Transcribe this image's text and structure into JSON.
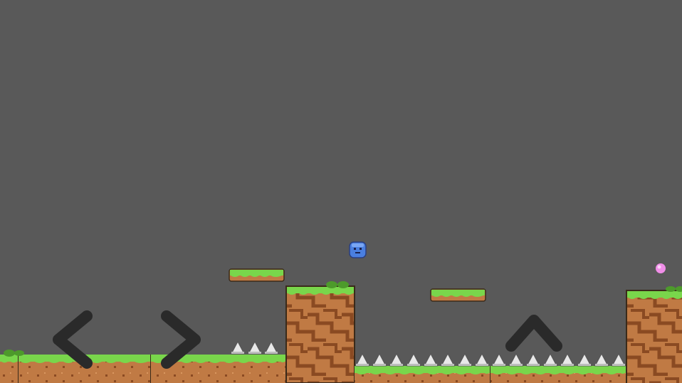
{
  "game": {
    "background_color": "#595959",
    "colors": {
      "grass": "#79d64b",
      "grass_dark": "#4d9a2b",
      "dirt": "#c07a44",
      "dirt_dark": "#8a4a22",
      "dirt_light": "#d99760",
      "spike": "#e8e8e8",
      "player": "#4a7fe0",
      "orb": "#f08ee8",
      "control": "#2a2a2a"
    },
    "player": {
      "type": "blue-slime"
    },
    "collectible": {
      "type": "pink-orb"
    },
    "hazards": {
      "type": "spikes"
    },
    "controls": {
      "left": {
        "icon": "chevron-left-icon"
      },
      "right": {
        "icon": "chevron-right-icon"
      },
      "jump": {
        "icon": "chevron-up-icon"
      }
    }
  }
}
